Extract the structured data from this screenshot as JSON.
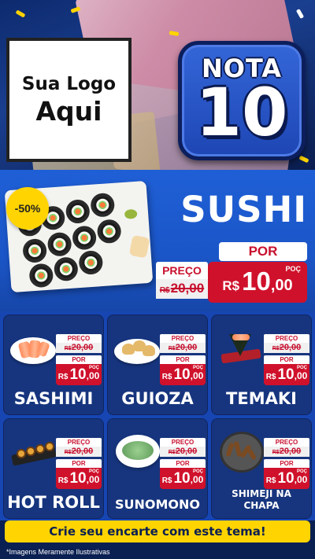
{
  "header": {
    "logo_line1": "Sua Logo",
    "logo_line2": "Aqui",
    "badge_word": "NOTA",
    "badge_number": "10"
  },
  "featured": {
    "name": "SUSHI",
    "discount": "-50%",
    "por_label": "POR",
    "preco_label": "PREÇO",
    "old_currency": "R$",
    "old_price": "20,00",
    "new_currency": "R$",
    "new_price_main": "10",
    "new_price_cents": ",00",
    "unit": "POÇ"
  },
  "price_labels": {
    "preco": "PREÇO",
    "por": "POR",
    "currency": "R$",
    "old_price": "20,00",
    "new_main": "10",
    "new_cents": ",00",
    "unit": "POÇ"
  },
  "products": [
    {
      "name": "SASHIMI",
      "icon": "sashimi-icon"
    },
    {
      "name": "GUIOZA",
      "icon": "guioza-icon"
    },
    {
      "name": "TEMAKI",
      "icon": "temaki-icon"
    },
    {
      "name": "HOT ROLL",
      "icon": "hot-roll-icon"
    },
    {
      "name": "SUNOMONO",
      "icon": "sunomono-icon"
    },
    {
      "name_line1": "SHIMEJI NA",
      "name_line2": "CHAPA",
      "icon": "shimeji-icon"
    }
  ],
  "cta": "Crie seu encarte com este tema!",
  "disclaimer": "*Imagens Meramente Ilustrativas",
  "colors": {
    "primary_blue": "#1f5fd6",
    "dark_blue": "#17357e",
    "price_red": "#d0112b",
    "accent_yellow": "#ffd400"
  }
}
